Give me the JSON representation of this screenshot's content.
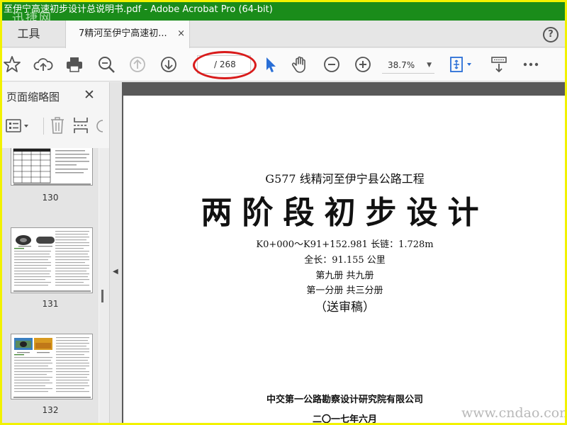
{
  "window": {
    "title": "至伊宁高速初步设计总说明书.pdf - Adobe Acrobat Pro (64-bit)",
    "watermark_top": "迅捷网",
    "watermark_bottom": "www.cndao.com"
  },
  "tabs": {
    "tools_label": "工具",
    "doc_label": "7精河至伊宁高速初...",
    "close_glyph": "×",
    "help_glyph": "?"
  },
  "toolbar": {
    "page_text": "/ 268",
    "zoom_value": "38.7%",
    "zoom_caret": "▼",
    "icons": [
      "star-icon",
      "cloud-upload-icon",
      "print-icon",
      "zoom-search-icon",
      "page-up-icon",
      "page-down-icon",
      "select-cursor-icon",
      "hand-tool-icon",
      "zoom-out-icon",
      "zoom-in-icon",
      "fit-page-icon",
      "scroll-mode-icon",
      "more-icon"
    ],
    "accent": "#2a6fd6",
    "highlight_color": "#d91b1b"
  },
  "sidebar": {
    "title": "页面缩略图",
    "close_glyph": "✕",
    "thumbnails": [
      {
        "label": "130"
      },
      {
        "label": "131"
      },
      {
        "label": "132"
      }
    ]
  },
  "collapse_glyph": "◀",
  "document": {
    "subtitle": "G577 线精河至伊宁县公路工程",
    "main_title": "两阶段初步设计",
    "line1": "K0+000～K91+152.981  长链：1.728m",
    "line2": "全长：91.155 公里",
    "line3": "第九册    共九册",
    "line4": "第一分册  共三分册",
    "line5": "（送审稿）",
    "org": "中交第一公路勘察设计研究院有限公司",
    "date": "二〇一七年六月"
  }
}
